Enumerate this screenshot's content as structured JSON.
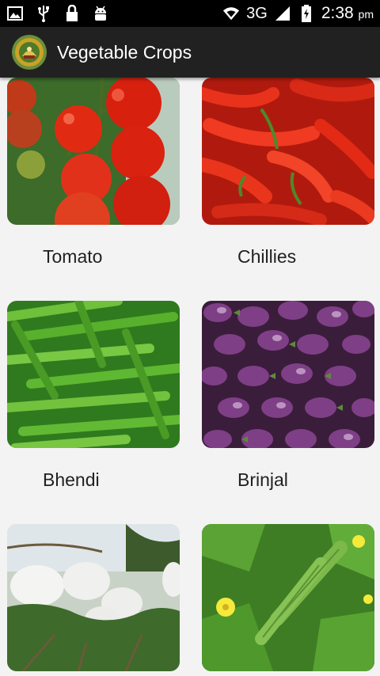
{
  "status_bar": {
    "network": "3G",
    "time": "2:38",
    "ampm": "pm",
    "icons": [
      "image-icon",
      "usb-icon",
      "lock-icon",
      "android-icon",
      "wifi-icon",
      "signal-icon",
      "battery-icon"
    ]
  },
  "app_bar": {
    "title": "Vegetable Crops",
    "logo_icon": "emblem-logo"
  },
  "crops": [
    {
      "name": "Tomato",
      "image": "tomato-photo"
    },
    {
      "name": "Chillies",
      "image": "chillies-photo"
    },
    {
      "name": "Bhendi",
      "image": "okra-photo"
    },
    {
      "name": "Brinjal",
      "image": "brinjal-photo"
    },
    {
      "name": "",
      "image": "white-gourd-photo"
    },
    {
      "name": "",
      "image": "ridge-gourd-photo"
    }
  ],
  "colors": {
    "status_bar": "#000000",
    "app_bar": "#212121",
    "background": "#f3f3f3"
  }
}
